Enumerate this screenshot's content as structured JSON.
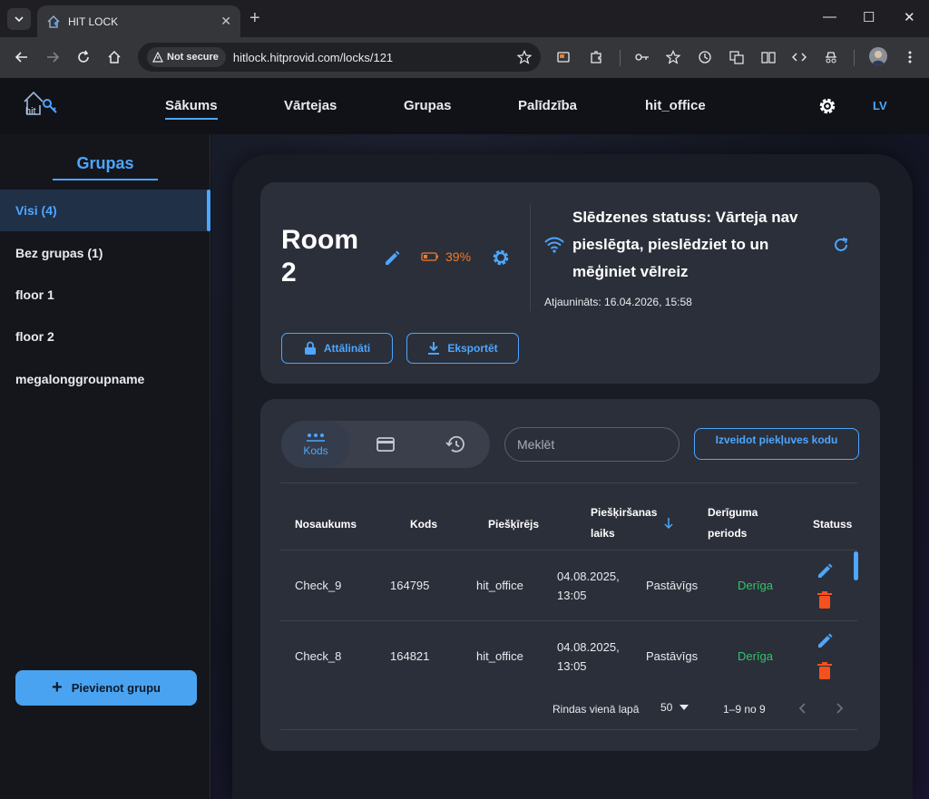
{
  "browser": {
    "tab_title": "HIT LOCK",
    "security_chip": "Not secure",
    "url": "hitlock.hitprovid.com/locks/121"
  },
  "header": {
    "nav": [
      "Sākums",
      "Vārtejas",
      "Grupas",
      "Palīdzība",
      "hit_office"
    ],
    "active_nav": "Sākums",
    "language": "LV"
  },
  "sidebar": {
    "title": "Grupas",
    "items": [
      {
        "label": "Visi (4)",
        "active": true
      },
      {
        "label": "Bez grupas (1)"
      },
      {
        "label": "floor 1"
      },
      {
        "label": "floor 2"
      },
      {
        "label": "megalonggroupname"
      }
    ],
    "add_button": "Pievienot grupu"
  },
  "lock": {
    "title": "Room 2",
    "battery": "39%",
    "status": "Slēdzenes statuss: Vārteja nav pieslēgta, pieslēdziet to un mēģiniet vēlreiz",
    "updated": "Atjaunināts: 16.04.2026, 15:58",
    "remote_button": "Attālināti",
    "export_button": "Eksportēt"
  },
  "codes": {
    "tabs": [
      "Kods",
      "",
      ""
    ],
    "search_placeholder": "Meklēt",
    "create_button": "Izveidot piekļuves kodu",
    "columns": [
      "Nosaukums",
      "Kods",
      "Piešķīrējs",
      "Piešķiršanas laiks",
      "Derīguma periods",
      "Statuss"
    ],
    "rows": [
      {
        "name": "Check_9",
        "code": "164795",
        "assigner": "hit_office",
        "time": "04.08.2025, 13:05",
        "period": "Pastāvīgs",
        "status": "Derīga"
      },
      {
        "name": "Check_8",
        "code": "164821",
        "assigner": "hit_office",
        "time": "04.08.2025, 13:05",
        "period": "Pastāvīgs",
        "status": "Derīga"
      }
    ],
    "rows_per_page_label": "Rindas vienā lapā",
    "rows_per_page": "50",
    "range": "1–9 no 9"
  },
  "colors": {
    "accent": "#4da6ff",
    "battery": "#f07a2e",
    "valid": "#33c46b",
    "delete": "#f4511e"
  }
}
